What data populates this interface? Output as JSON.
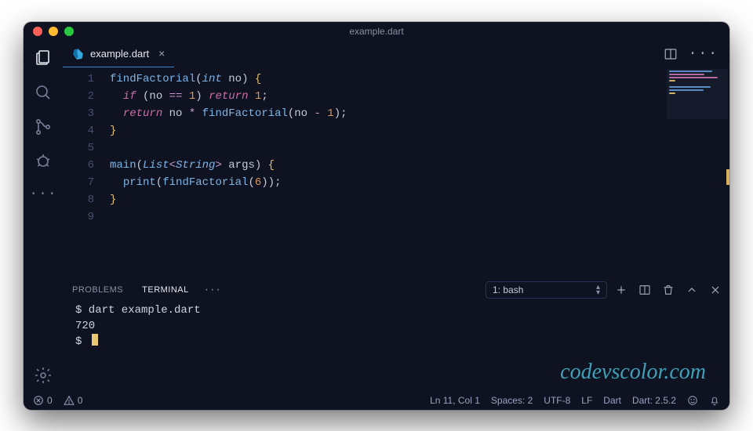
{
  "title": "example.dart",
  "tab": {
    "filename": "example.dart",
    "close": "×"
  },
  "code": {
    "lines": [
      {
        "n": 1,
        "tokens": [
          [
            "fn",
            "findFactorial"
          ],
          [
            "pn",
            "("
          ],
          [
            "type",
            "int"
          ],
          [
            "pn",
            " no"
          ],
          [
            "pn",
            ") "
          ],
          [
            "br",
            "{"
          ]
        ]
      },
      {
        "n": 2,
        "tokens": [
          [
            "pn",
            "  "
          ],
          [
            "kw",
            "if"
          ],
          [
            "pn",
            " (no "
          ],
          [
            "op",
            "=="
          ],
          [
            "pn",
            " "
          ],
          [
            "num",
            "1"
          ],
          [
            "pn",
            ") "
          ],
          [
            "kw",
            "return"
          ],
          [
            "pn",
            " "
          ],
          [
            "num",
            "1"
          ],
          [
            "pn",
            ";"
          ]
        ]
      },
      {
        "n": 3,
        "tokens": [
          [
            "pn",
            "  "
          ],
          [
            "kw",
            "return"
          ],
          [
            "pn",
            " no "
          ],
          [
            "op",
            "*"
          ],
          [
            "pn",
            " "
          ],
          [
            "fn",
            "findFactorial"
          ],
          [
            "pn",
            "(no "
          ],
          [
            "op",
            "-"
          ],
          [
            "pn",
            " "
          ],
          [
            "num",
            "1"
          ],
          [
            "pn",
            ");"
          ]
        ]
      },
      {
        "n": 4,
        "tokens": [
          [
            "br",
            "}"
          ]
        ]
      },
      {
        "n": 5,
        "tokens": [
          [
            "pn",
            ""
          ]
        ]
      },
      {
        "n": 6,
        "tokens": [
          [
            "fn",
            "main"
          ],
          [
            "pn",
            "("
          ],
          [
            "type",
            "List"
          ],
          [
            "op",
            "<"
          ],
          [
            "type",
            "String"
          ],
          [
            "op",
            ">"
          ],
          [
            "pn",
            " args) "
          ],
          [
            "br",
            "{"
          ]
        ]
      },
      {
        "n": 7,
        "tokens": [
          [
            "pn",
            "  "
          ],
          [
            "fn",
            "print"
          ],
          [
            "pn",
            "("
          ],
          [
            "fn",
            "findFactorial"
          ],
          [
            "pn",
            "("
          ],
          [
            "num",
            "6"
          ],
          [
            "pn",
            "));"
          ]
        ]
      },
      {
        "n": 8,
        "tokens": [
          [
            "br",
            "}"
          ]
        ]
      },
      {
        "n": 9,
        "tokens": [
          [
            "pn",
            ""
          ]
        ]
      }
    ]
  },
  "panel": {
    "tabs": {
      "problems": "PROBLEMS",
      "terminal": "TERMINAL"
    },
    "selector": "1: bash",
    "terminal": [
      "$ dart example.dart",
      "720",
      "$ "
    ]
  },
  "status": {
    "errors": "0",
    "warnings": "0",
    "lncol": "Ln 11, Col 1",
    "spaces": "Spaces: 2",
    "encoding": "UTF-8",
    "eol": "LF",
    "lang": "Dart",
    "version": "Dart: 2.5.2"
  },
  "watermark": "codevscolor.com",
  "traffic": {
    "close": "#ff5f57",
    "min": "#febc2e",
    "max": "#28c840"
  }
}
